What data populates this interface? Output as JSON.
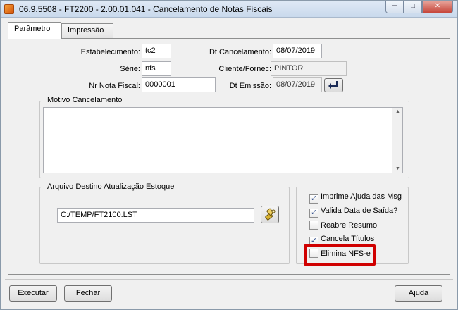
{
  "window": {
    "title": "06.9.5508 - FT2200 - 2.00.01.041 - Cancelamento de Notas Fiscais",
    "icon": "datasul-app-icon",
    "controls": {
      "minimize": "─",
      "maximize": "□",
      "close": "✕"
    }
  },
  "tabs": [
    {
      "label": "Parâmetro",
      "active": true
    },
    {
      "label": "Impressão",
      "active": false
    }
  ],
  "form": {
    "estabelecimento": {
      "label": "Estabelecimento:",
      "value": "tc2"
    },
    "serie": {
      "label": "Série:",
      "value": "nfs"
    },
    "nr_nota": {
      "label": "Nr Nota Fiscal:",
      "value": "0000001"
    },
    "dt_cancelamento": {
      "label": "Dt Cancelamento:",
      "value": "08/07/2019"
    },
    "cliente": {
      "label": "Cliente/Fornec:",
      "value": "PINTOR"
    },
    "dt_emissao": {
      "label": "Dt Emissão:",
      "value": "08/07/2019"
    }
  },
  "motivo": {
    "legend": "Motivo Cancelamento",
    "value": ""
  },
  "arquivo": {
    "legend": "Arquivo Destino Atualização Estoque",
    "value": "C:/TEMP/FT2100.LST"
  },
  "options": [
    {
      "label": "Imprime Ajuda das Msg",
      "checked": true,
      "check": "✓"
    },
    {
      "label": "Valida Data de Saída?",
      "checked": true,
      "check": "✓"
    },
    {
      "label": "Reabre Resumo",
      "checked": false,
      "check": ""
    },
    {
      "label": "Cancela Títulos",
      "checked": true,
      "check": "✓"
    },
    {
      "label": "Elimina NFS-e",
      "checked": false,
      "check": ""
    }
  ],
  "highlight_color": "#d00000",
  "buttons": {
    "execute": "Executar",
    "close": "Fechar",
    "help": "Ajuda"
  }
}
